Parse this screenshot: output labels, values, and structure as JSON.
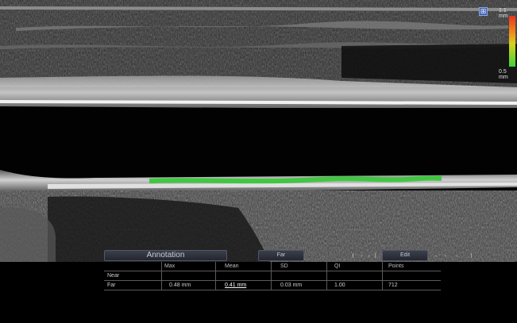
{
  "color_scale": {
    "top_label": "1.1 mm",
    "bottom_label": "0.5 mm"
  },
  "zoom_icon": {
    "name": "zoom-icon",
    "glyph": "⊞"
  },
  "controls": {
    "annotation_label": "Annotation",
    "far_label": "Far",
    "edit_label": "Edit"
  },
  "table": {
    "headers": [
      "",
      "Max",
      "Mean",
      "SD",
      "QI",
      "Points"
    ],
    "rows": [
      {
        "label": "Near",
        "max": "",
        "mean": "",
        "sd": "",
        "qi": "",
        "points": ""
      },
      {
        "label": "Far",
        "max": "0.48 mm",
        "mean": "0.41 mm",
        "sd": "0.03 mm",
        "qi": "1.00",
        "points": "712"
      }
    ]
  },
  "colors": {
    "trace": "#32c832",
    "scale_top": "#e8341f",
    "scale_bottom": "#3fd23a"
  }
}
